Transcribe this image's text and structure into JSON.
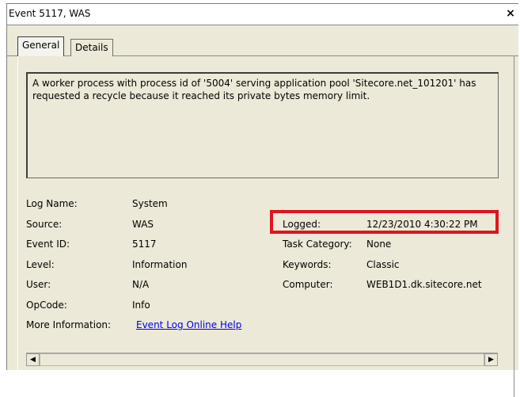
{
  "window": {
    "title": "Event 5117, WAS",
    "close_glyph": "×"
  },
  "tabs": [
    {
      "label": "General",
      "active": true
    },
    {
      "label": "Details",
      "active": false
    }
  ],
  "description": "A worker process with process id of '5004' serving application pool 'Sitecore.net_101201' has requested a recycle because it reached its private bytes memory limit.",
  "fields_left": [
    {
      "label": "Log Name:",
      "value": "System"
    },
    {
      "label": "Source:",
      "value": "WAS"
    },
    {
      "label": "Event ID:",
      "value": "5117"
    },
    {
      "label": "Level:",
      "value": "Information"
    },
    {
      "label": "User:",
      "value": "N/A"
    },
    {
      "label": "OpCode:",
      "value": "Info"
    },
    {
      "label": "More Information:",
      "value": "Event Log Online Help"
    }
  ],
  "fields_right": [
    {
      "label": "Logged:",
      "value": "12/23/2010 4:30:22 PM"
    },
    {
      "label": "Task Category:",
      "value": "None"
    },
    {
      "label": "Keywords:",
      "value": "Classic"
    },
    {
      "label": "Computer:",
      "value": "WEB1D1.dk.sitecore.net"
    }
  ],
  "colors": {
    "highlight": "#e0141e",
    "link": "#0000ee",
    "background": "#ece9d8"
  },
  "scrollbar": {
    "left_arrow": "◀",
    "right_arrow": "▶"
  }
}
